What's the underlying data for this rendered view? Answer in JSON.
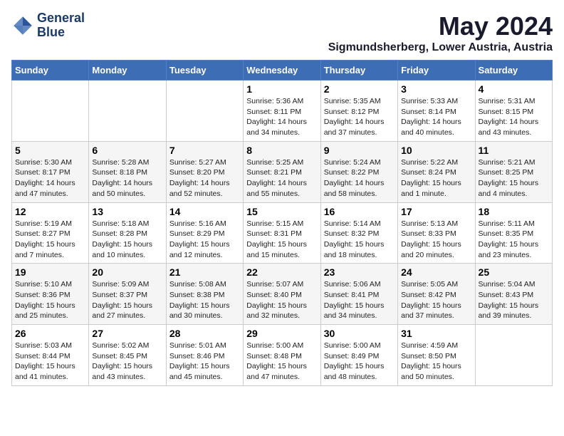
{
  "header": {
    "logo_line1": "General",
    "logo_line2": "Blue",
    "month_year": "May 2024",
    "location": "Sigmundsherberg, Lower Austria, Austria"
  },
  "days_of_week": [
    "Sunday",
    "Monday",
    "Tuesday",
    "Wednesday",
    "Thursday",
    "Friday",
    "Saturday"
  ],
  "weeks": [
    [
      {
        "day": "",
        "info": ""
      },
      {
        "day": "",
        "info": ""
      },
      {
        "day": "",
        "info": ""
      },
      {
        "day": "1",
        "info": "Sunrise: 5:36 AM\nSunset: 8:11 PM\nDaylight: 14 hours\nand 34 minutes."
      },
      {
        "day": "2",
        "info": "Sunrise: 5:35 AM\nSunset: 8:12 PM\nDaylight: 14 hours\nand 37 minutes."
      },
      {
        "day": "3",
        "info": "Sunrise: 5:33 AM\nSunset: 8:14 PM\nDaylight: 14 hours\nand 40 minutes."
      },
      {
        "day": "4",
        "info": "Sunrise: 5:31 AM\nSunset: 8:15 PM\nDaylight: 14 hours\nand 43 minutes."
      }
    ],
    [
      {
        "day": "5",
        "info": "Sunrise: 5:30 AM\nSunset: 8:17 PM\nDaylight: 14 hours\nand 47 minutes."
      },
      {
        "day": "6",
        "info": "Sunrise: 5:28 AM\nSunset: 8:18 PM\nDaylight: 14 hours\nand 50 minutes."
      },
      {
        "day": "7",
        "info": "Sunrise: 5:27 AM\nSunset: 8:20 PM\nDaylight: 14 hours\nand 52 minutes."
      },
      {
        "day": "8",
        "info": "Sunrise: 5:25 AM\nSunset: 8:21 PM\nDaylight: 14 hours\nand 55 minutes."
      },
      {
        "day": "9",
        "info": "Sunrise: 5:24 AM\nSunset: 8:22 PM\nDaylight: 14 hours\nand 58 minutes."
      },
      {
        "day": "10",
        "info": "Sunrise: 5:22 AM\nSunset: 8:24 PM\nDaylight: 15 hours\nand 1 minute."
      },
      {
        "day": "11",
        "info": "Sunrise: 5:21 AM\nSunset: 8:25 PM\nDaylight: 15 hours\nand 4 minutes."
      }
    ],
    [
      {
        "day": "12",
        "info": "Sunrise: 5:19 AM\nSunset: 8:27 PM\nDaylight: 15 hours\nand 7 minutes."
      },
      {
        "day": "13",
        "info": "Sunrise: 5:18 AM\nSunset: 8:28 PM\nDaylight: 15 hours\nand 10 minutes."
      },
      {
        "day": "14",
        "info": "Sunrise: 5:16 AM\nSunset: 8:29 PM\nDaylight: 15 hours\nand 12 minutes."
      },
      {
        "day": "15",
        "info": "Sunrise: 5:15 AM\nSunset: 8:31 PM\nDaylight: 15 hours\nand 15 minutes."
      },
      {
        "day": "16",
        "info": "Sunrise: 5:14 AM\nSunset: 8:32 PM\nDaylight: 15 hours\nand 18 minutes."
      },
      {
        "day": "17",
        "info": "Sunrise: 5:13 AM\nSunset: 8:33 PM\nDaylight: 15 hours\nand 20 minutes."
      },
      {
        "day": "18",
        "info": "Sunrise: 5:11 AM\nSunset: 8:35 PM\nDaylight: 15 hours\nand 23 minutes."
      }
    ],
    [
      {
        "day": "19",
        "info": "Sunrise: 5:10 AM\nSunset: 8:36 PM\nDaylight: 15 hours\nand 25 minutes."
      },
      {
        "day": "20",
        "info": "Sunrise: 5:09 AM\nSunset: 8:37 PM\nDaylight: 15 hours\nand 27 minutes."
      },
      {
        "day": "21",
        "info": "Sunrise: 5:08 AM\nSunset: 8:38 PM\nDaylight: 15 hours\nand 30 minutes."
      },
      {
        "day": "22",
        "info": "Sunrise: 5:07 AM\nSunset: 8:40 PM\nDaylight: 15 hours\nand 32 minutes."
      },
      {
        "day": "23",
        "info": "Sunrise: 5:06 AM\nSunset: 8:41 PM\nDaylight: 15 hours\nand 34 minutes."
      },
      {
        "day": "24",
        "info": "Sunrise: 5:05 AM\nSunset: 8:42 PM\nDaylight: 15 hours\nand 37 minutes."
      },
      {
        "day": "25",
        "info": "Sunrise: 5:04 AM\nSunset: 8:43 PM\nDaylight: 15 hours\nand 39 minutes."
      }
    ],
    [
      {
        "day": "26",
        "info": "Sunrise: 5:03 AM\nSunset: 8:44 PM\nDaylight: 15 hours\nand 41 minutes."
      },
      {
        "day": "27",
        "info": "Sunrise: 5:02 AM\nSunset: 8:45 PM\nDaylight: 15 hours\nand 43 minutes."
      },
      {
        "day": "28",
        "info": "Sunrise: 5:01 AM\nSunset: 8:46 PM\nDaylight: 15 hours\nand 45 minutes."
      },
      {
        "day": "29",
        "info": "Sunrise: 5:00 AM\nSunset: 8:48 PM\nDaylight: 15 hours\nand 47 minutes."
      },
      {
        "day": "30",
        "info": "Sunrise: 5:00 AM\nSunset: 8:49 PM\nDaylight: 15 hours\nand 48 minutes."
      },
      {
        "day": "31",
        "info": "Sunrise: 4:59 AM\nSunset: 8:50 PM\nDaylight: 15 hours\nand 50 minutes."
      },
      {
        "day": "",
        "info": ""
      }
    ]
  ]
}
